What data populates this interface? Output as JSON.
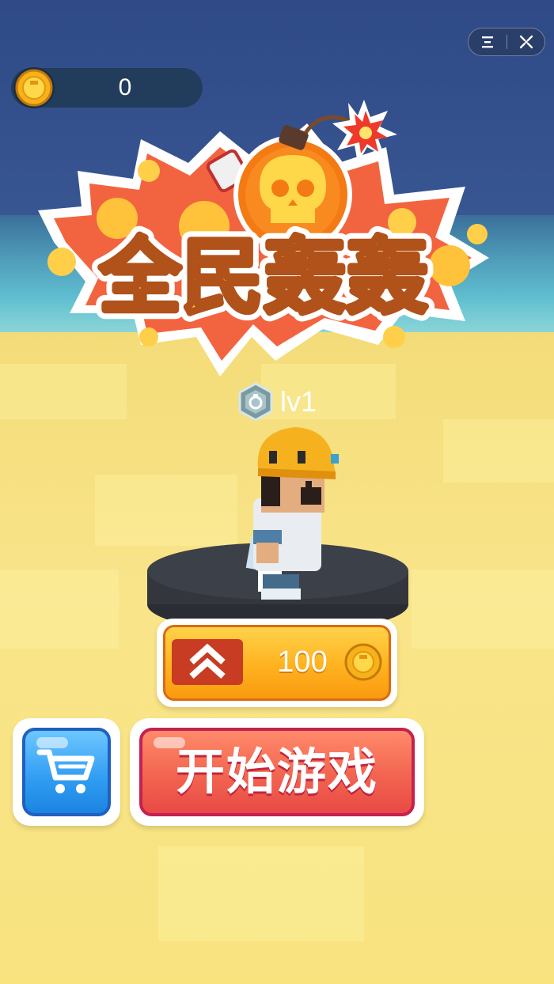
{
  "hud": {
    "coin_count": "0",
    "menu_icon": "menu-icon",
    "close_icon": "close-target-icon"
  },
  "logo": {
    "title": "全民轰轰",
    "icon": "skull-bomb-icon"
  },
  "player": {
    "level": "lv1",
    "badge_icon": "hexagon-badge-icon"
  },
  "upgrade": {
    "icon": "double-chevron-up-icon",
    "cost": "100",
    "currency_icon": "coin-icon"
  },
  "shop": {
    "icon": "cart-icon"
  },
  "start": {
    "label": "开始游戏"
  },
  "colors": {
    "sky": "#2f4a86",
    "sand": "#f8e27a",
    "upgrade_orange": "#ffb21f",
    "start_red": "#f26450",
    "shop_blue": "#2f9cf2"
  }
}
